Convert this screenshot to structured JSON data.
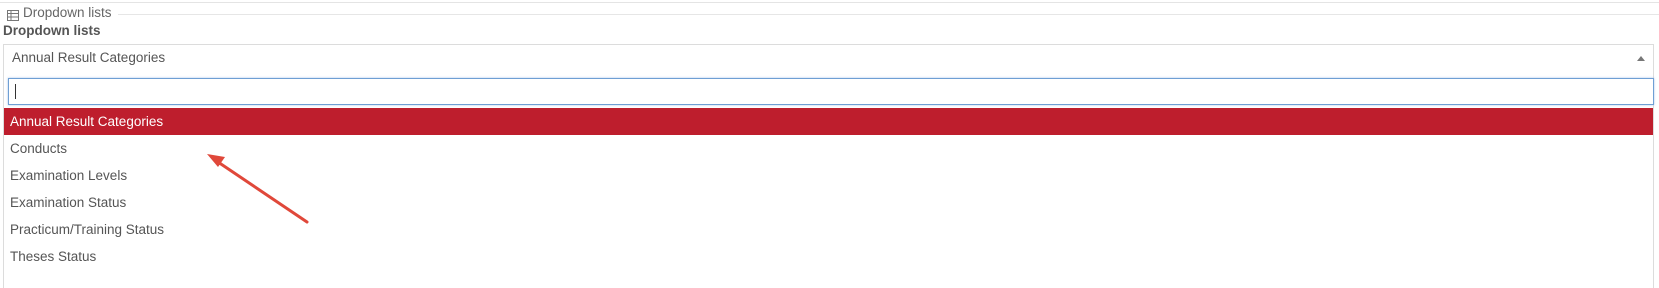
{
  "panel": {
    "title": "Dropdown lists",
    "icon": "table-icon"
  },
  "field": {
    "label": "Dropdown lists"
  },
  "select": {
    "value": "Annual Result Categories",
    "caret_icon": "caret-up-icon"
  },
  "search": {
    "value": ""
  },
  "options": [
    {
      "label": "Annual Result Categories",
      "selected": true
    },
    {
      "label": "Conducts",
      "selected": false
    },
    {
      "label": "Examination Levels",
      "selected": false
    },
    {
      "label": "Examination Status",
      "selected": false
    },
    {
      "label": "Practicum/Training Status",
      "selected": false
    },
    {
      "label": "Theses Status",
      "selected": false
    }
  ],
  "colors": {
    "highlight": "#be1e2d",
    "annotation_arrow": "#e0483a",
    "search_border": "#6f9fd4"
  }
}
